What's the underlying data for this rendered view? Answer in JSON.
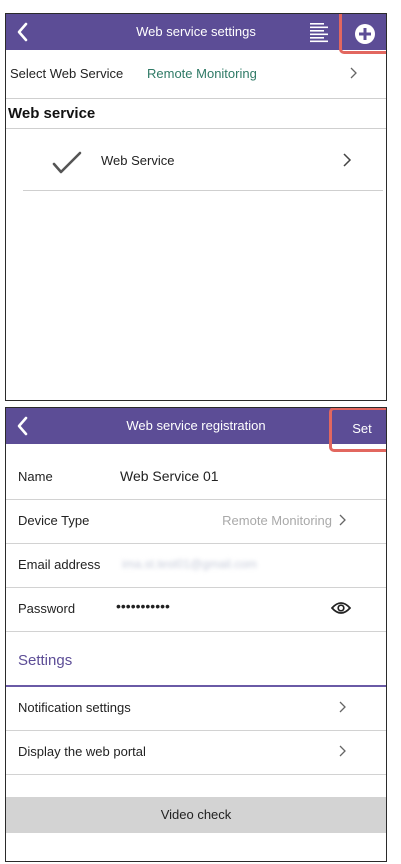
{
  "screen1": {
    "header": {
      "title": "Web service settings"
    },
    "select_row": {
      "label": "Select Web Service",
      "value": "Remote Monitoring"
    },
    "section_title": "Web service",
    "service_item": {
      "label": "Web Service",
      "selected": true
    }
  },
  "screen2": {
    "header": {
      "title": "Web service registration",
      "set_label": "Set"
    },
    "fields": {
      "name": {
        "label": "Name",
        "value": "Web Service 01"
      },
      "device_type": {
        "label": "Device Type",
        "value": "Remote Monitoring"
      },
      "email": {
        "label": "Email address",
        "value": "ima.st.test01@gmail.com"
      },
      "password": {
        "label": "Password",
        "value": "•••••••••••"
      }
    },
    "settings_title": "Settings",
    "settings_items": [
      {
        "label": "Notification settings"
      },
      {
        "label": "Display the web portal"
      }
    ],
    "video_check_label": "Video check"
  },
  "colors": {
    "header": "#5c4d96",
    "highlight": "#e2675f",
    "value_green": "#2f7a66"
  }
}
